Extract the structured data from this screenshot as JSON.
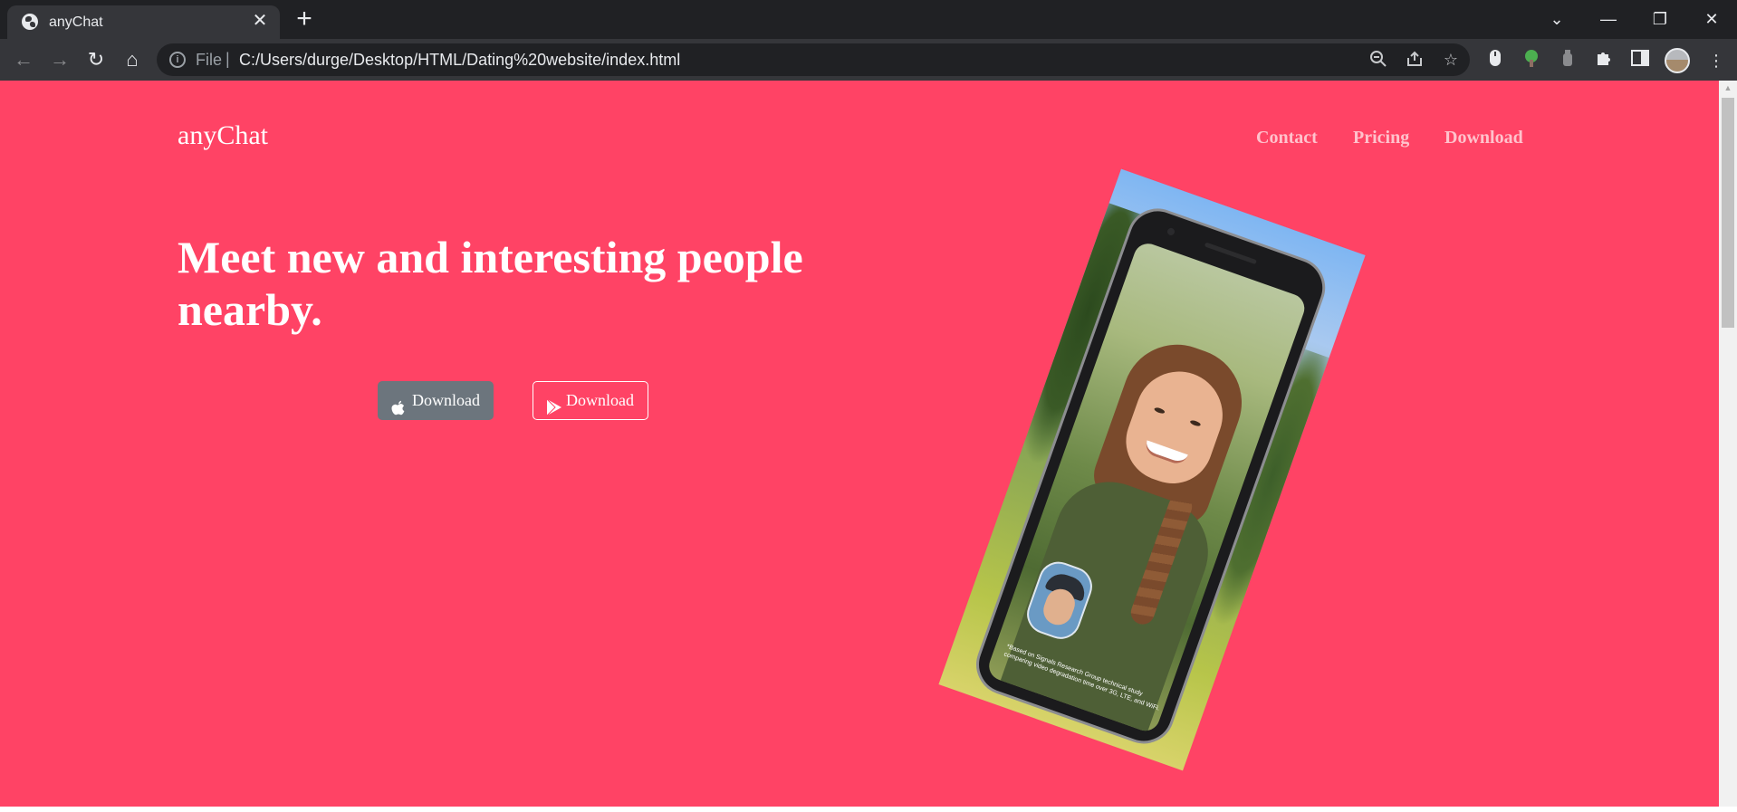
{
  "browser": {
    "tab_title": "anyChat",
    "address_scheme": "File",
    "address_url": "C:/Users/durge/Desktop/HTML/Dating%20website/index.html",
    "tab_close_glyph": "✕",
    "new_tab_glyph": "+",
    "window_controls": {
      "tab_search": "⌄",
      "minimize": "—",
      "restore": "❐",
      "close": "✕"
    },
    "nav_glyphs": {
      "back": "←",
      "forward": "→",
      "reload": "↻",
      "home": "⌂"
    },
    "icons": [
      "zoom-out-icon",
      "share-icon",
      "bookmark-star-icon",
      "extension-mouse-icon",
      "extension-tree-icon",
      "extension-bottle-icon",
      "extensions-puzzle-icon",
      "side-panel-icon",
      "profile-avatar",
      "menu-kebab-icon"
    ]
  },
  "page": {
    "brand": "anyChat",
    "nav": [
      "Contact",
      "Pricing",
      "Download"
    ],
    "headline": "Meet new and interesting people nearby.",
    "buttons": {
      "apple_label": "Download",
      "play_label": "Download"
    },
    "phone_caption": "*Based on Signals Research Group technical study comparing video degradation time over 3G, LTE, and WiFi.",
    "colors": {
      "background": "#ff4365",
      "nav_link": "#ffc2cc",
      "apple_button": "#6c757d"
    }
  }
}
